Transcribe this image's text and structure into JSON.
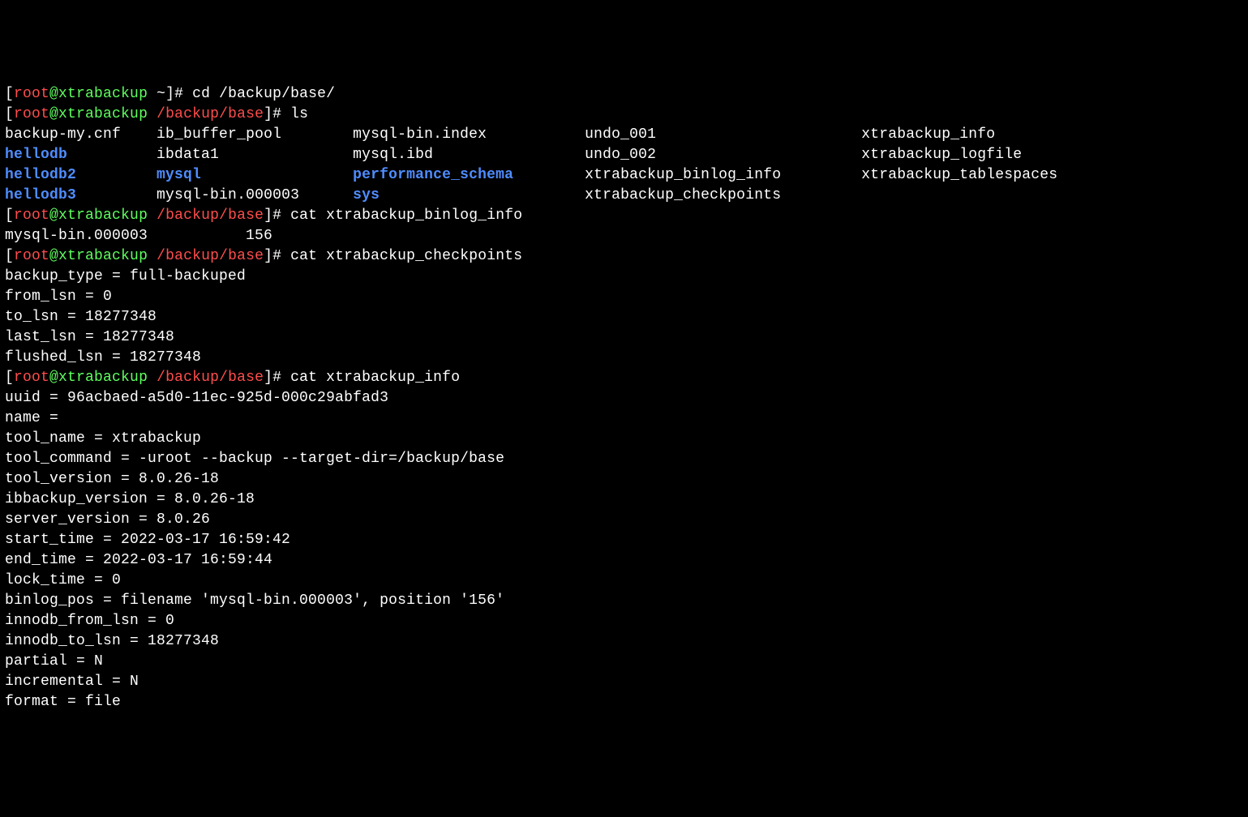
{
  "prompts": [
    {
      "user": "root",
      "host": "xtrabackup",
      "cwd": "~",
      "command": "cd /backup/base/"
    },
    {
      "user": "root",
      "host": "xtrabackup",
      "cwd": "/backup/base",
      "command": "ls"
    },
    {
      "user": "root",
      "host": "xtrabackup",
      "cwd": "/backup/base",
      "command": "cat xtrabackup_binlog_info"
    },
    {
      "user": "root",
      "host": "xtrabackup",
      "cwd": "/backup/base",
      "command": "cat xtrabackup_checkpoints"
    },
    {
      "user": "root",
      "host": "xtrabackup",
      "cwd": "/backup/base",
      "command": "cat xtrabackup_info"
    }
  ],
  "ls_rows": [
    [
      {
        "text": "backup-my.cnf",
        "dir": false
      },
      {
        "text": "ib_buffer_pool",
        "dir": false
      },
      {
        "text": "mysql-bin.index",
        "dir": false
      },
      {
        "text": "undo_001",
        "dir": false
      },
      {
        "text": "xtrabackup_info",
        "dir": false
      }
    ],
    [
      {
        "text": "hellodb",
        "dir": true
      },
      {
        "text": "ibdata1",
        "dir": false
      },
      {
        "text": "mysql.ibd",
        "dir": false
      },
      {
        "text": "undo_002",
        "dir": false
      },
      {
        "text": "xtrabackup_logfile",
        "dir": false
      }
    ],
    [
      {
        "text": "hellodb2",
        "dir": true
      },
      {
        "text": "mysql",
        "dir": true
      },
      {
        "text": "performance_schema",
        "dir": true
      },
      {
        "text": "xtrabackup_binlog_info",
        "dir": false
      },
      {
        "text": "xtrabackup_tablespaces",
        "dir": false
      }
    ],
    [
      {
        "text": "hellodb3",
        "dir": true
      },
      {
        "text": "mysql-bin.000003",
        "dir": false
      },
      {
        "text": "sys",
        "dir": true
      },
      {
        "text": "xtrabackup_checkpoints",
        "dir": false
      },
      {
        "text": "",
        "dir": false
      }
    ]
  ],
  "binlog_info": {
    "file": "mysql-bin.000003",
    "pos": "156"
  },
  "checkpoints": [
    "backup_type = full-backuped",
    "from_lsn = 0",
    "to_lsn = 18277348",
    "last_lsn = 18277348",
    "flushed_lsn = 18277348"
  ],
  "info": [
    "uuid = 96acbaed-a5d0-11ec-925d-000c29abfad3",
    "name = ",
    "tool_name = xtrabackup",
    "tool_command = -uroot --backup --target-dir=/backup/base",
    "tool_version = 8.0.26-18",
    "ibbackup_version = 8.0.26-18",
    "server_version = 8.0.26",
    "start_time = 2022-03-17 16:59:42",
    "end_time = 2022-03-17 16:59:44",
    "lock_time = 0",
    "binlog_pos = filename 'mysql-bin.000003', position '156'",
    "innodb_from_lsn = 0",
    "innodb_to_lsn = 18277348",
    "partial = N",
    "incremental = N",
    "format = file"
  ],
  "ls_widths": [
    17,
    22,
    26,
    31,
    0
  ]
}
